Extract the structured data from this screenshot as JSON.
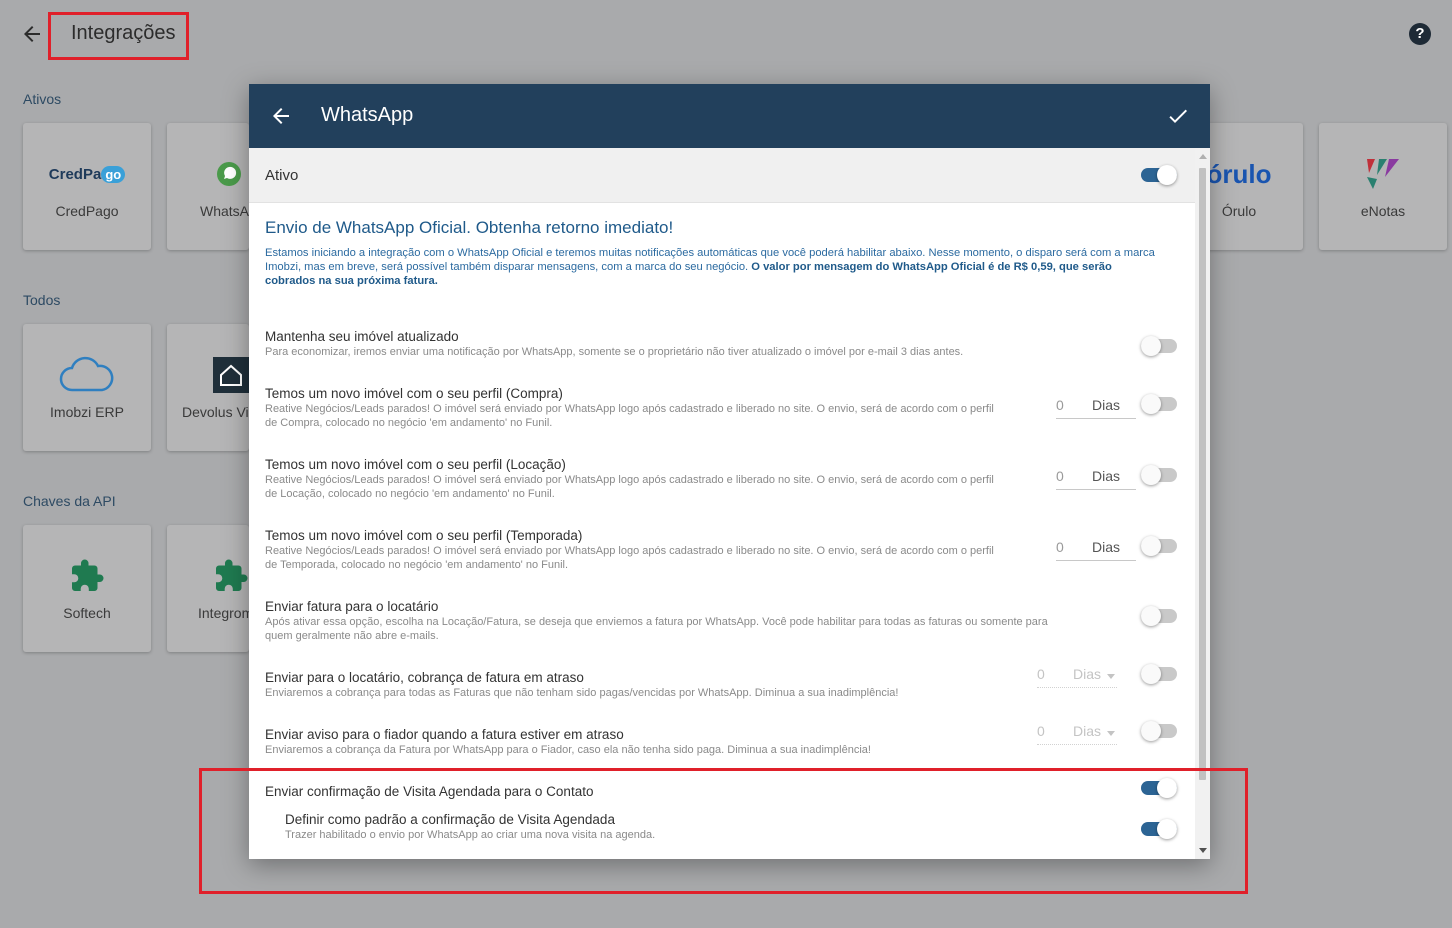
{
  "page": {
    "title": "Integrações"
  },
  "sections": {
    "ativos": "Ativos",
    "todos": "Todos",
    "chaves": "Chaves da API"
  },
  "cards": {
    "credpago": "CredPago",
    "whatsapp": "WhatsApp",
    "orulo": "Órulo",
    "enotas": "eNotas",
    "imobzi_erp": "Imobzi ERP",
    "devolus": "Devolus Vistoria",
    "softech": "Softech",
    "integrom": "Integrom"
  },
  "logos": {
    "credpago_text": "CredPa",
    "credpago_go": "go",
    "orulo_text": "órulo"
  },
  "dialog": {
    "title": "WhatsApp",
    "active_label": "Ativo",
    "intro_title": "Envio de WhatsApp Oficial. Obtenha retorno imediato!",
    "intro_text": "Estamos iniciando a integração com o WhatsApp Oficial e teremos muitas notificações automáticas que você poderá habilitar abaixo. Nesse momento, o disparo será com a marca Imobzi, mas em breve, será possível também disparar mensagens, com a marca do seu negócio. ",
    "intro_bold": "O valor por mensagem do WhatsApp Oficial é de R$ 0,59, que serão cobrados na sua próxima fatura."
  },
  "settings": [
    {
      "title": "Mantenha seu imóvel atualizado",
      "desc": "Para economizar, iremos enviar uma notificação por WhatsApp, somente se o proprietário não tiver atualizado o imóvel por e-mail 3 dias antes.",
      "enabled": false
    },
    {
      "title": "Temos um novo imóvel com o seu perfil (Compra)",
      "desc": "Reative Negócios/Leads parados! O imóvel será enviado por WhatsApp logo após cadastrado e liberado no site. O envio, será de acordo com o perfil de Compra, colocado no negócio 'em andamento' no Funil.",
      "days": "0",
      "unit": "Dias",
      "enabled": false
    },
    {
      "title": "Temos um novo imóvel com o seu perfil (Locação)",
      "desc": "Reative Negócios/Leads parados! O imóvel será enviado por WhatsApp logo após cadastrado e liberado no site. O envio, será de acordo com o perfil de Locação, colocado no negócio 'em andamento' no Funil.",
      "days": "0",
      "unit": "Dias",
      "enabled": false
    },
    {
      "title": "Temos um novo imóvel com o seu perfil (Temporada)",
      "desc": "Reative Negócios/Leads parados! O imóvel será enviado por WhatsApp logo após cadastrado e liberado no site. O envio, será de acordo com o perfil de Temporada, colocado no negócio 'em andamento' no Funil.",
      "days": "0",
      "unit": "Dias",
      "enabled": false
    },
    {
      "title": "Enviar fatura para o locatário",
      "desc": "Após ativar essa opção, escolha na Locação/Fatura, se deseja que enviemos a fatura por WhatsApp. Você pode habilitar para todas as faturas ou somente para quem geralmente não abre e-mails.",
      "enabled": false
    },
    {
      "title": "Enviar para o locatário, cobrança de fatura em atraso",
      "desc": "Enviaremos a cobrança para todas as Faturas que não tenham sido pagas/vencidas por WhatsApp. Diminua a sua inadimplência!",
      "days": "0",
      "unit": "Dias",
      "enabled": false
    },
    {
      "title": "Enviar aviso para o fiador quando a fatura estiver em atraso",
      "desc": "Enviaremos a cobrança da Fatura por WhatsApp para o Fiador, caso ela não tenha sido paga. Diminua a sua inadimplência!",
      "days": "0",
      "unit": "Dias",
      "enabled": false
    },
    {
      "title": "Enviar confirmação de Visita Agendada para o Contato",
      "desc": "",
      "enabled": true
    },
    {
      "title": "Definir como padrão a confirmação de Visita Agendada",
      "desc": "Trazer habilitado o envio por WhatsApp ao criar uma nova visita na agenda.",
      "enabled": true
    }
  ],
  "colors": {
    "header": "#22405c",
    "accent": "#2c6494",
    "highlight": "#e0202a"
  }
}
